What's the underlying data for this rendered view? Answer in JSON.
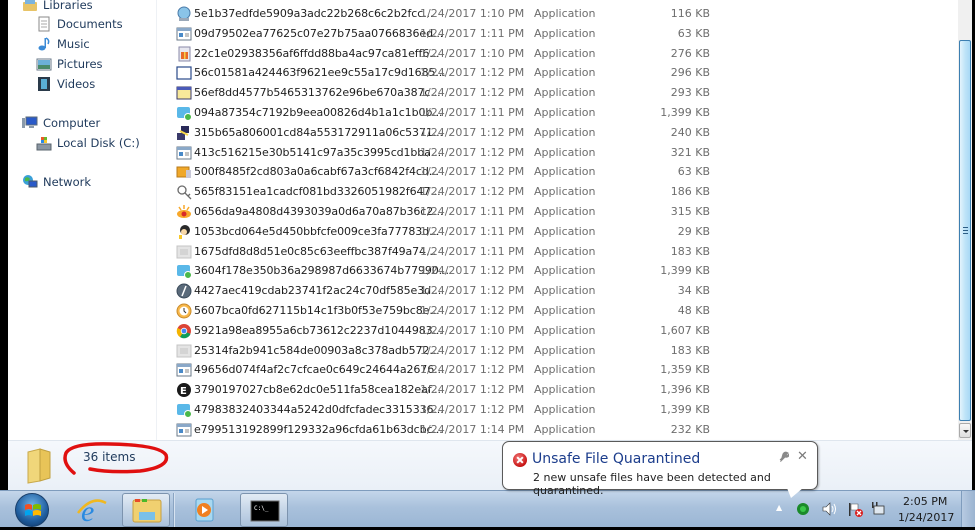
{
  "sidebar": {
    "items": [
      {
        "label": "Libraries",
        "icon": "libraries-icon"
      },
      {
        "label": "Documents",
        "icon": "documents-icon"
      },
      {
        "label": "Music",
        "icon": "music-icon"
      },
      {
        "label": "Pictures",
        "icon": "pictures-icon"
      },
      {
        "label": "Videos",
        "icon": "videos-icon"
      },
      {
        "label": "Computer",
        "icon": "computer-icon"
      },
      {
        "label": "Local Disk (C:)",
        "icon": "local-disk-icon"
      },
      {
        "label": "Network",
        "icon": "network-icon"
      }
    ]
  },
  "files": [
    {
      "name": "5e1b37edfde5909a3adc22b268c6c2b2fcc...",
      "date": "1/24/2017 1:10 PM",
      "type": "Application",
      "size": "116 KB",
      "icon": "globe-app-icon"
    },
    {
      "name": "09d79502ea77625c07e27b75aa0766836ed...",
      "date": "1/24/2017 1:11 PM",
      "type": "Application",
      "size": "63 KB",
      "icon": "generic-app-icon"
    },
    {
      "name": "22c1e02938356af6ffdd88ba4ac97ca81eff6...",
      "date": "1/24/2017 1:10 PM",
      "type": "Application",
      "size": "276 KB",
      "icon": "gift-app-icon"
    },
    {
      "name": "56c01581a424463f9621ee9c55a17c9d1685...",
      "date": "1/24/2017 1:12 PM",
      "type": "Application",
      "size": "296 KB",
      "icon": "window-app-icon"
    },
    {
      "name": "56ef8dd4577b5465313762e96be670a387c...",
      "date": "1/24/2017 1:12 PM",
      "type": "Application",
      "size": "293 KB",
      "icon": "window-yellow-app-icon"
    },
    {
      "name": "094a87354c7192b9eea00826d4b1a1c1b0b...",
      "date": "1/24/2017 1:11 PM",
      "type": "Application",
      "size": "1,399 KB",
      "icon": "installer-app-icon"
    },
    {
      "name": "315b65a806001cd84a553172911a06c5371...",
      "date": "1/24/2017 1:12 PM",
      "type": "Application",
      "size": "240 KB",
      "icon": "network-tool-app-icon"
    },
    {
      "name": "413c516215e30b5141c97a35c3995cd1bba...",
      "date": "1/24/2017 1:12 PM",
      "type": "Application",
      "size": "321 KB",
      "icon": "generic-app-icon"
    },
    {
      "name": "500f8485f2cd803a0a6cabf67a3cf6842f4cd...",
      "date": "1/24/2017 1:12 PM",
      "type": "Application",
      "size": "63 KB",
      "icon": "box-app-icon"
    },
    {
      "name": "565f83151ea1cadcf081bd3326051982f647...",
      "date": "1/24/2017 1:12 PM",
      "type": "Application",
      "size": "186 KB",
      "icon": "key-app-icon"
    },
    {
      "name": "0656da9a4808d4393039a0d6a70a87b36c2...",
      "date": "1/24/2017 1:11 PM",
      "type": "Application",
      "size": "315 KB",
      "icon": "eye-app-icon"
    },
    {
      "name": "1053bcd064e5d450bbfcfe009ce3fa77783d...",
      "date": "1/24/2017 1:11 PM",
      "type": "Application",
      "size": "29 KB",
      "icon": "character-app-icon"
    },
    {
      "name": "1675dfd8d8d51e0c85c63eeffbc387f49a74...",
      "date": "1/24/2017 1:11 PM",
      "type": "Application",
      "size": "183 KB",
      "icon": "faded-app-icon"
    },
    {
      "name": "3604f178e350b36a298987d6633674b77990...",
      "date": "1/24/2017 1:12 PM",
      "type": "Application",
      "size": "1,399 KB",
      "icon": "installer-app-icon"
    },
    {
      "name": "4427aec419cdab23741f2ac24c70df585e3d...",
      "date": "1/24/2017 1:12 PM",
      "type": "Application",
      "size": "34 KB",
      "icon": "compass-app-icon"
    },
    {
      "name": "5607bca0fd627115b14c1f3b0f53e759bc8e...",
      "date": "1/24/2017 1:12 PM",
      "type": "Application",
      "size": "48 KB",
      "icon": "clock-app-icon"
    },
    {
      "name": "5921a98ea8955a6cb73612c2237d1044983...",
      "date": "1/24/2017 1:10 PM",
      "type": "Application",
      "size": "1,607 KB",
      "icon": "chrome-icon"
    },
    {
      "name": "25314fa2b941c584de00903a8c378adb572...",
      "date": "1/24/2017 1:12 PM",
      "type": "Application",
      "size": "183 KB",
      "icon": "faded-app-icon"
    },
    {
      "name": "49656d074f4af2c7cfcae0c649c24644a2676...",
      "date": "1/24/2017 1:12 PM",
      "type": "Application",
      "size": "1,359 KB",
      "icon": "generic-app-icon"
    },
    {
      "name": "3790197027cb8e62dc0e511fa58cea182eaf...",
      "date": "1/24/2017 1:12 PM",
      "type": "Application",
      "size": "1,396 KB",
      "icon": "e-logo-app-icon"
    },
    {
      "name": "47983832403344a5242d0dfcfadec3315336...",
      "date": "1/24/2017 1:12 PM",
      "type": "Application",
      "size": "1,399 KB",
      "icon": "installer-app-icon"
    },
    {
      "name": "e799513192899f129332a96cfda61b63dcbc...",
      "date": "1/24/2017 1:14 PM",
      "type": "Application",
      "size": "232 KB",
      "icon": "generic-app-icon"
    }
  ],
  "details": {
    "item_count": "36 items"
  },
  "notification": {
    "title": "Unsafe File Quarantined",
    "message": "2 new unsafe files have been detected and quarantined.",
    "settings_glyph": "🔧",
    "close_glyph": "✕"
  },
  "taskbar": {
    "buttons": [
      {
        "name": "internet-explorer",
        "active": false
      },
      {
        "name": "windows-explorer",
        "active": true
      },
      {
        "name": "windows-media-player",
        "active": false
      },
      {
        "name": "command-prompt",
        "active": true,
        "text": "C:\\_"
      }
    ]
  },
  "tray": {
    "time": "2:05 PM",
    "date": "1/24/2017",
    "show_hidden_glyph": "▲"
  },
  "colors": {
    "annotation_red": "#e01010",
    "link_blue": "#1c3d8c",
    "taskbar": "#a9c1dc"
  }
}
